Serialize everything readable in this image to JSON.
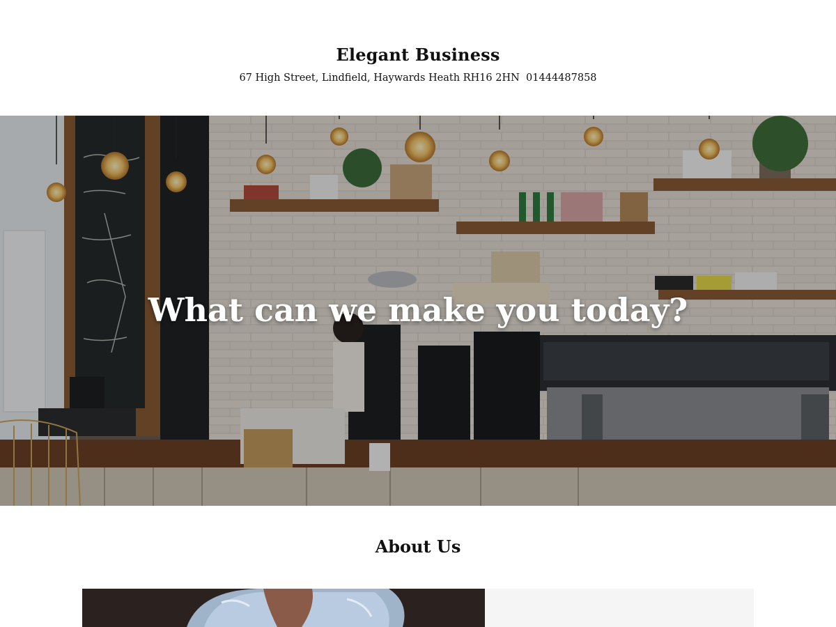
{
  "header": {
    "title": "Elegant Business",
    "address": "67 High Street, Lindfield, Haywards Heath RH16 2HN",
    "phone": "01444487858"
  },
  "hero": {
    "heading": "What can we make you today?",
    "image": "coffee-shop-counter-photo"
  },
  "about": {
    "heading": "About Us",
    "image": "person-photo"
  },
  "colors": {
    "background": "#ffffff",
    "text": "#111111",
    "hero_text": "#ffffff",
    "panel": "#f5f5f5"
  }
}
